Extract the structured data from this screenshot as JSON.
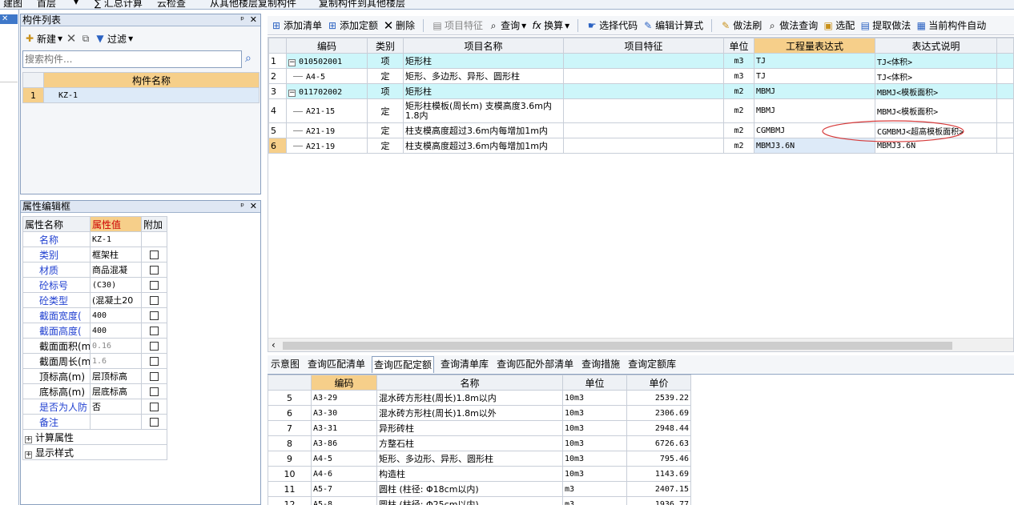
{
  "topbar": {
    "items": [
      "建图",
      "首层",
      "∑ 汇总计算",
      "云检查",
      "从其他楼层复制构件",
      "复制构件到其他楼层"
    ]
  },
  "left_strip": {
    "close": "✕"
  },
  "component_list": {
    "title": "构件列表",
    "pin": "ᵖ",
    "close": "✕",
    "new_label": "新建",
    "filter_label": "过滤",
    "search_placeholder": "搜索构件...",
    "col_header": "构件名称",
    "rows": [
      {
        "num": "1",
        "name": "KZ-1"
      }
    ]
  },
  "property_panel": {
    "title": "属性编辑框",
    "pin": "ᵖ",
    "close": "✕",
    "headers": [
      "属性名称",
      "属性值",
      "附加"
    ],
    "rows": [
      {
        "name": "名称",
        "value": "KZ-1",
        "blue": true,
        "check": false,
        "grey": false
      },
      {
        "name": "类别",
        "value": "框架柱",
        "blue": true,
        "check": true,
        "grey": false
      },
      {
        "name": "材质",
        "value": "商品混凝",
        "blue": true,
        "check": true,
        "grey": false
      },
      {
        "name": "砼标号",
        "value": "(C30)",
        "blue": true,
        "check": true,
        "grey": false
      },
      {
        "name": "砼类型",
        "value": "(混凝土20",
        "blue": true,
        "check": true,
        "grey": false
      },
      {
        "name": "截面宽度(",
        "value": "400",
        "blue": true,
        "check": true,
        "grey": false
      },
      {
        "name": "截面高度(",
        "value": "400",
        "blue": true,
        "check": true,
        "grey": false
      },
      {
        "name": "截面面积(m",
        "value": "0.16",
        "blue": false,
        "check": true,
        "grey": true
      },
      {
        "name": "截面周长(m",
        "value": "1.6",
        "blue": false,
        "check": true,
        "grey": true
      },
      {
        "name": "顶标高(m)",
        "value": "层顶标高",
        "blue": false,
        "check": true,
        "grey": false
      },
      {
        "name": "底标高(m)",
        "value": "层底标高",
        "blue": false,
        "check": true,
        "grey": false
      },
      {
        "name": "是否为人防",
        "value": "否",
        "blue": true,
        "check": true,
        "grey": false
      },
      {
        "name": "备注",
        "value": "",
        "blue": true,
        "check": true,
        "grey": false
      }
    ],
    "groups": [
      "计算属性",
      "显示样式"
    ]
  },
  "main_toolbar": {
    "buttons": [
      "添加清单",
      "添加定额",
      "删除",
      "项目特征",
      "查询",
      "换算",
      "选择代码",
      "编辑计算式",
      "做法刷",
      "做法查询",
      "选配",
      "提取做法",
      "当前构件自动"
    ]
  },
  "main_table": {
    "headers": [
      "编码",
      "类别",
      "项目名称",
      "项目特征",
      "单位",
      "工程量表达式",
      "表达式说明"
    ],
    "rows": [
      {
        "num": "1",
        "code": "010502001",
        "type": "项",
        "name": "矩形柱",
        "feature": "",
        "unit": "m3",
        "expr": "TJ",
        "desc": "TJ<体积>",
        "parent": true,
        "cyan": true
      },
      {
        "num": "2",
        "code": "A4-5",
        "type": "定",
        "name": "矩形、多边形、异形、圆形柱",
        "feature": "",
        "unit": "m3",
        "expr": "TJ",
        "desc": "TJ<体积>",
        "parent": false,
        "cyan": false
      },
      {
        "num": "3",
        "code": "011702002",
        "type": "项",
        "name": "矩形柱",
        "feature": "",
        "unit": "m2",
        "expr": "MBMJ",
        "desc": "MBMJ<模板面积>",
        "parent": true,
        "cyan": true
      },
      {
        "num": "4",
        "code": "A21-15",
        "type": "定",
        "name": "矩形柱模板(周长m) 支模高度3.6m内",
        "name2": "1.8内",
        "feature": "",
        "unit": "m2",
        "expr": "MBMJ",
        "desc": "MBMJ<模板面积>",
        "parent": false,
        "cyan": false
      },
      {
        "num": "5",
        "code": "A21-19",
        "type": "定",
        "name": "柱支模高度超过3.6m内每增加1m内",
        "feature": "",
        "unit": "m2",
        "expr": "CGMBMJ",
        "desc": "CGMBMJ<超高模板面积>",
        "parent": false,
        "cyan": false
      },
      {
        "num": "6",
        "code": "A21-19",
        "type": "定",
        "name": "柱支模高度超过3.6m内每增加1m内",
        "feature": "",
        "unit": "m2",
        "expr": "MBMJ3.6N",
        "desc": "MBMJ3.6N",
        "parent": false,
        "cyan": false
      }
    ]
  },
  "bottom_tabs": [
    "示意图",
    "查询匹配清单",
    "查询匹配定额",
    "查询清单库",
    "查询匹配外部清单",
    "查询措施",
    "查询定额库"
  ],
  "bottom_table": {
    "headers": [
      "编码",
      "名称",
      "单位",
      "单价"
    ],
    "rows": [
      {
        "num": "5",
        "code": "A3-29",
        "name": "混水砖方形柱(周长)1.8m以内",
        "unit": "10m3",
        "price": "2539.22"
      },
      {
        "num": "6",
        "code": "A3-30",
        "name": "混水砖方形柱(周长)1.8m以外",
        "unit": "10m3",
        "price": "2306.69"
      },
      {
        "num": "7",
        "code": "A3-31",
        "name": "异形砖柱",
        "unit": "10m3",
        "price": "2948.44"
      },
      {
        "num": "8",
        "code": "A3-86",
        "name": "方整石柱",
        "unit": "10m3",
        "price": "6726.63"
      },
      {
        "num": "9",
        "code": "A4-5",
        "name": "矩形、多边形、异形、圆形柱",
        "unit": "10m3",
        "price": "795.46"
      },
      {
        "num": "10",
        "code": "A4-6",
        "name": "构造柱",
        "unit": "10m3",
        "price": "1143.69"
      },
      {
        "num": "11",
        "code": "A5-7",
        "name": "圆柱 (柱径: Φ18cm以内)",
        "unit": "m3",
        "price": "2407.15"
      },
      {
        "num": "12",
        "code": "A5-8",
        "name": "圆柱 (柱径: Φ25cm以内)",
        "unit": "m3",
        "price": "1936.77"
      }
    ]
  },
  "colors": {
    "highlight_header": "#f6cf8a",
    "cyan_row": "#cdf6fa",
    "annotation": "#d63a3a"
  }
}
